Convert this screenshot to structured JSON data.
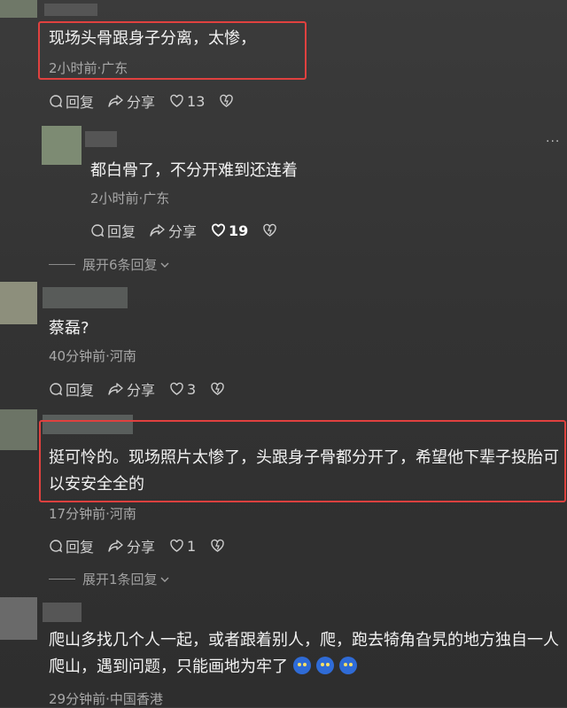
{
  "comments": [
    {
      "text": "现场头骨跟身子分离，太惨，",
      "meta": "2小时前·广东",
      "reply": "回复",
      "share": "分享",
      "likes": "13"
    },
    {
      "text": "都白骨了，不分开难到还连着",
      "meta": "2小时前·广东",
      "reply": "回复",
      "share": "分享",
      "likes": "19",
      "more": "···"
    },
    {
      "text": "蔡磊?",
      "meta": "40分钟前·河南",
      "reply": "回复",
      "share": "分享",
      "likes": "3"
    },
    {
      "text": "挺可怜的。现场照片太惨了，头跟身子骨都分开了，希望他下辈子投胎可以安安全全的",
      "meta": "17分钟前·河南",
      "reply": "回复",
      "share": "分享",
      "likes": "1"
    },
    {
      "text": "爬山多找几个人一起，或者跟着别人，爬，跑去犄角旮旯的地方独自一人爬山，遇到问题，只能画地为牢了",
      "meta": "29分钟前·中国香港"
    }
  ],
  "expand": [
    {
      "label": "展开6条回复"
    },
    {
      "label": "展开1条回复"
    }
  ],
  "colors": {
    "highlight": "#e0413f",
    "background": "#343434"
  },
  "icons": [
    "comment-icon",
    "share-icon",
    "heart-icon",
    "dislike-heart-icon",
    "chevron-down-icon",
    "crying-emoji-icon"
  ]
}
